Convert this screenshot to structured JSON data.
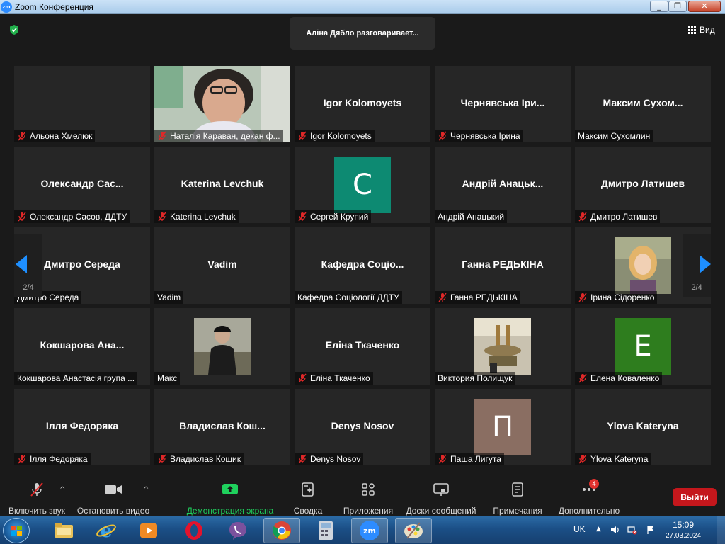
{
  "window": {
    "title": "Zoom Конференция",
    "logo_text": "zm"
  },
  "meeting": {
    "speaker_banner": "Аліна Дябло разговаривает...",
    "view_label": "Вид"
  },
  "paging": {
    "left": "2/4",
    "right": "2/4"
  },
  "participants": [
    {
      "display": "",
      "name": "Альона Хмелюк",
      "muted": true,
      "type": "blank"
    },
    {
      "display": "",
      "name": "Наталія Караван, декан ф...",
      "muted": true,
      "type": "video"
    },
    {
      "display": "Igor Kolomoyets",
      "name": "Igor Kolomoyets",
      "muted": true,
      "type": "name"
    },
    {
      "display": "Чернявська  Іри...",
      "name": "Чернявська Ірина",
      "muted": true,
      "type": "name"
    },
    {
      "display": "Максим  Сухом...",
      "name": "Максим Сухомлин",
      "muted": false,
      "type": "name"
    },
    {
      "display": "Олександр  Сас...",
      "name": "Олександр Сасов, ДДТУ",
      "muted": true,
      "type": "name"
    },
    {
      "display": "Katerina Levchuk",
      "name": "Katerina Levchuk",
      "muted": true,
      "type": "name"
    },
    {
      "display": "C",
      "name": "Сергей Крупий",
      "muted": true,
      "type": "letter",
      "color": "#0d8a72"
    },
    {
      "display": "Андрій  Анацьк...",
      "name": "Андрій Анацький",
      "muted": false,
      "type": "name"
    },
    {
      "display": "Дмитро Латишев",
      "name": "Дмитро Латишев",
      "muted": true,
      "type": "name"
    },
    {
      "display": "Дмитро Середа",
      "name": "Дмитро Середа",
      "muted": false,
      "type": "name"
    },
    {
      "display": "Vadim",
      "name": "Vadim",
      "muted": false,
      "type": "name"
    },
    {
      "display": "Кафедра  Соціо...",
      "name": "Кафедра Соціології ДДТУ",
      "muted": false,
      "type": "name"
    },
    {
      "display": "Ганна РЕДЬКІНА",
      "name": "Ганна РЕДЬКІНА",
      "muted": true,
      "type": "name"
    },
    {
      "display": "",
      "name": "Ірина Сідоренко",
      "muted": true,
      "type": "photo-woman"
    },
    {
      "display": "Кокшарова  Ана...",
      "name": "Кокшарова Анастасія група ...",
      "muted": false,
      "type": "name"
    },
    {
      "display": "",
      "name": "Макс",
      "muted": false,
      "type": "photo-man"
    },
    {
      "display": "Еліна Ткаченко",
      "name": "Еліна Ткаченко",
      "muted": true,
      "type": "name"
    },
    {
      "display": "",
      "name": "Виктория Полищук",
      "muted": false,
      "type": "photo-fountain"
    },
    {
      "display": "E",
      "name": "Елена Коваленко",
      "muted": true,
      "type": "letter",
      "color": "#2e7d1e"
    },
    {
      "display": "Ілля Федоряка",
      "name": "Ілля Федоряка",
      "muted": true,
      "type": "name"
    },
    {
      "display": "Владислав  Кош...",
      "name": "Владислав Кошик",
      "muted": true,
      "type": "name"
    },
    {
      "display": "Denys Nosov",
      "name": "Denys Nosov",
      "muted": true,
      "type": "name"
    },
    {
      "display": "П",
      "name": "Паша Лигута",
      "muted": true,
      "type": "letter",
      "color": "#8a6e62"
    },
    {
      "display": "Ylova Kateryna",
      "name": "Ylova Kateryna",
      "muted": true,
      "type": "name"
    }
  ],
  "toolbar": {
    "unmute": "Включить звук",
    "stop_video": "Остановить видео",
    "share": "Демонстрация экрана",
    "summary": "Сводка",
    "apps": "Приложения",
    "whiteboards": "Доски сообщений",
    "notes": "Примечания",
    "more": "Дополнительно",
    "more_badge": "4",
    "leave": "Выйти"
  },
  "taskbar": {
    "language": "UK",
    "time": "15:09",
    "date": "27.03.2024",
    "zoom_app_label": "zm",
    "apps": [
      "file-explorer-icon",
      "internet-explorer-icon",
      "media-player-icon",
      "opera-icon",
      "viber-icon",
      "chrome-icon",
      "calculator-icon",
      "zoom-icon",
      "paint-icon"
    ]
  },
  "colors": {
    "accent_blue": "#1e8fff",
    "share_green": "#1fd15d",
    "leave_red": "#c4171c",
    "mute_red": "#e02828"
  }
}
